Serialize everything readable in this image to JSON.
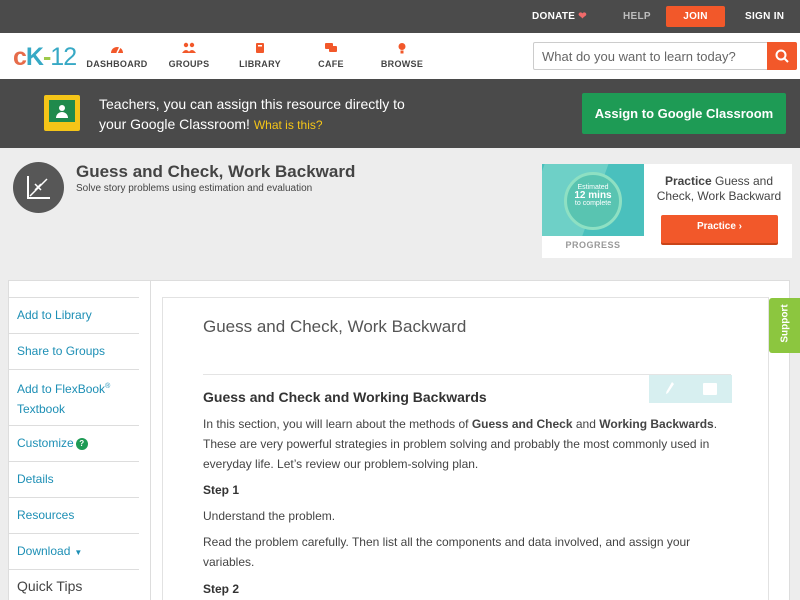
{
  "topbar": {
    "donate": "DONATE",
    "help": "HELP",
    "join": "JOIN",
    "signin": "SIGN IN"
  },
  "nav": {
    "logo_c": "c",
    "logo_k": "K",
    "logo_dash": "-",
    "logo_num": "12",
    "items": [
      {
        "label": "DASHBOARD",
        "icon": "dashboard-icon"
      },
      {
        "label": "GROUPS",
        "icon": "groups-icon"
      },
      {
        "label": "LIBRARY",
        "icon": "library-icon"
      },
      {
        "label": "CAFE",
        "icon": "cafe-icon"
      },
      {
        "label": "BROWSE",
        "icon": "browse-icon"
      }
    ],
    "search_placeholder": "What do you want to learn today?"
  },
  "classroom": {
    "line1": "Teachers, you can assign this resource directly to",
    "line2": "your Google Classroom!",
    "what_is_this": "What is this?",
    "button": "Assign to Google Classroom"
  },
  "concept": {
    "title": "Guess and Check, Work Backward",
    "subtitle": "Solve story problems using estimation and evaluation"
  },
  "practice": {
    "estimated": "Estimated",
    "mins": "12 mins",
    "to_complete": "to complete",
    "progress_label": "PROGRESS",
    "desc_bold": "Practice",
    "desc_rest": " Guess and Check, Work Backward",
    "button": "Practice"
  },
  "sidebar": {
    "add_library": "Add to Library",
    "share_groups": "Share to Groups",
    "add_flexbook_1": "Add to FlexBook",
    "add_flexbook_reg": "®",
    "add_flexbook_2": "Textbook",
    "customize": "Customize",
    "customize_help": "?",
    "details": "Details",
    "resources": "Resources",
    "download": "Download",
    "quick_tips": "Quick Tips"
  },
  "article": {
    "heading": "Guess and Check, Work Backward",
    "subheading": "Guess and Check and Working Backwards",
    "p1_a": "In this section, you will learn about the methods of ",
    "p1_b": "Guess and Check",
    "p1_c": " and ",
    "p1_d": "Working Backwards",
    "p1_e": ". These are very powerful strategies in problem solving and probably the most commonly used in everyday life. Let’s review our problem-solving plan.",
    "step1": "Step 1",
    "p2": "Understand the problem.",
    "p3": "Read the problem carefully. Then list all the components and data involved, and assign your variables.",
    "step2": "Step 2"
  },
  "support": "Support",
  "colors": {
    "accent_orange": "#f2582a",
    "google_green": "#1e9b55",
    "link_blue": "#1d8fb5",
    "support_green": "#8cc63f"
  }
}
